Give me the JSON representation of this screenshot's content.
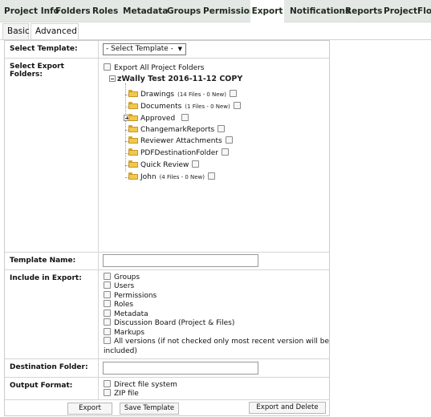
{
  "top_tabs": [
    "Project Info",
    "Folders",
    "Roles",
    "Metadata",
    "Groups",
    "Permissions",
    "Export",
    "Notifications",
    "Reports",
    "ProjectFlow"
  ],
  "active_top_tab": "Export",
  "sub_tabs": [
    "Basic",
    "Advanced"
  ],
  "active_sub_tab": "Advanced",
  "form": {
    "select_template": {
      "label": "Select Template:",
      "value": "- Select Template -"
    },
    "export_folders": {
      "label": "Select Export Folders:",
      "all_label": "Export All Project Folders",
      "root": "zWally Test 2016-11-12 COPY",
      "folders": [
        {
          "name": "Drawings",
          "info": "(14 Files - 0 New)",
          "expandable": false
        },
        {
          "name": "Documents",
          "info": "(1 Files - 0 New)",
          "expandable": false
        },
        {
          "name": "Approved",
          "info": "",
          "expandable": true
        },
        {
          "name": "ChangemarkReports",
          "info": "",
          "expandable": false
        },
        {
          "name": "Reviewer Attachments",
          "info": "",
          "expandable": false
        },
        {
          "name": "PDFDestinationFolder",
          "info": "",
          "expandable": false
        },
        {
          "name": "Quick Review",
          "info": "",
          "expandable": false
        },
        {
          "name": "John",
          "info": "(4 Files - 0 New)",
          "expandable": false
        }
      ]
    },
    "template_name": {
      "label": "Template Name:",
      "value": ""
    },
    "include": {
      "label": "Include in Export:",
      "options": [
        "Groups",
        "Users",
        "Permissions",
        "Roles",
        "Metadata",
        "Discussion Board (Project & Files)",
        "Markups"
      ],
      "all_versions_line1": "All versions (if not checked only most recent version will be",
      "all_versions_line2": "included)"
    },
    "destination": {
      "label": "Destination Folder:",
      "value": ""
    },
    "output_format": {
      "label": "Output Format:",
      "options": [
        "Direct file system",
        "ZIP file"
      ]
    }
  },
  "buttons": {
    "export": "Export",
    "save_template": "Save Template",
    "export_delete": "Export and Delete"
  }
}
